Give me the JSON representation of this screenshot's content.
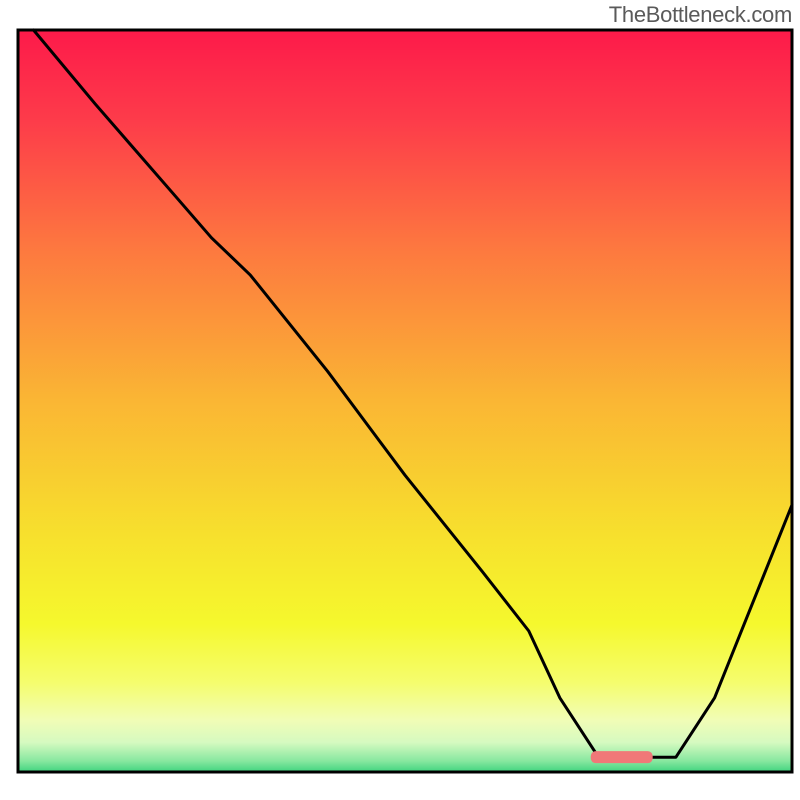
{
  "watermark": "TheBottleneck.com",
  "chart_data": {
    "type": "line",
    "title": "",
    "xlabel": "",
    "ylabel": "",
    "x_range": [
      0,
      100
    ],
    "y_range": [
      0,
      100
    ],
    "series": [
      {
        "name": "bottleneck-curve",
        "x": [
          2,
          10,
          20,
          25,
          30,
          40,
          50,
          60,
          66,
          70,
          75,
          80,
          85,
          90,
          100
        ],
        "y": [
          100,
          90,
          78,
          72,
          67,
          54,
          40,
          27,
          19,
          10,
          2,
          2,
          2,
          10,
          36
        ]
      }
    ],
    "marker": {
      "name": "optimal-point",
      "x_start": 74,
      "x_end": 82,
      "y": 2,
      "color": "#f07878"
    },
    "gradient_stops": [
      {
        "offset": 0.0,
        "color": "#fd1a4a"
      },
      {
        "offset": 0.12,
        "color": "#fd3b4a"
      },
      {
        "offset": 0.3,
        "color": "#fd7a3f"
      },
      {
        "offset": 0.5,
        "color": "#fab634"
      },
      {
        "offset": 0.68,
        "color": "#f7e02d"
      },
      {
        "offset": 0.8,
        "color": "#f5f82d"
      },
      {
        "offset": 0.88,
        "color": "#f5fd6e"
      },
      {
        "offset": 0.93,
        "color": "#f1fdb6"
      },
      {
        "offset": 0.96,
        "color": "#d6fac0"
      },
      {
        "offset": 0.985,
        "color": "#88e8a0"
      },
      {
        "offset": 1.0,
        "color": "#3fd37e"
      }
    ],
    "frame_color": "#000000",
    "frame_stroke_width": 3,
    "curve_color": "#000000",
    "curve_stroke_width": 3
  }
}
